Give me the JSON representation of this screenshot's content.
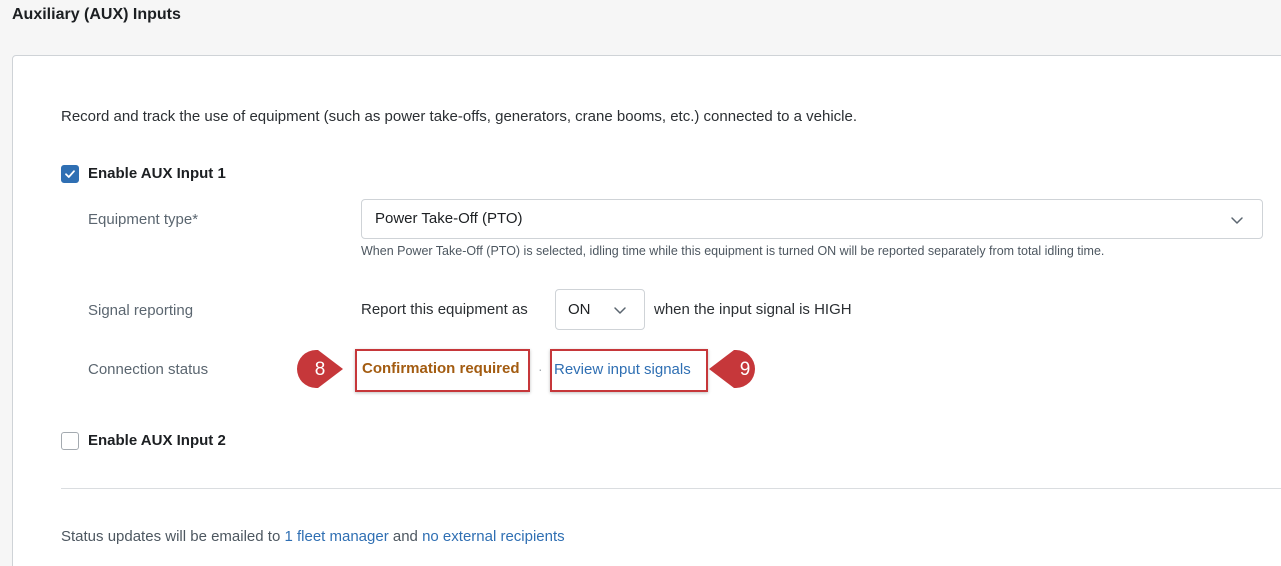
{
  "section": {
    "title": "Auxiliary (AUX) Inputs"
  },
  "description": "Record and track the use of equipment (such as power take-offs, generators, crane booms, etc.) connected to a vehicle.",
  "aux1": {
    "checkbox_label": "Enable AUX Input 1",
    "checked": true,
    "equipment_type": {
      "label": "Equipment type*",
      "value": "Power Take-Off (PTO)",
      "helper": "When Power Take-Off (PTO) is selected, idling time while this equipment is turned ON will be reported separately from total idling time."
    },
    "signal_reporting": {
      "label": "Signal reporting",
      "prefix": "Report this equipment as",
      "value": "ON",
      "suffix": "when the input signal is HIGH"
    },
    "connection_status": {
      "label": "Connection status",
      "status": "Confirmation required",
      "separator": "·",
      "link": "Review input signals"
    }
  },
  "aux2": {
    "checkbox_label": "Enable AUX Input 2",
    "checked": false
  },
  "footer": {
    "prefix": "Status updates will be emailed to",
    "link1": "1 fleet manager",
    "middle": "and",
    "link2": "no external recipients"
  },
  "annotations": {
    "badge_left": "8",
    "badge_right": "9"
  },
  "colors": {
    "accent": "#2f6fb3",
    "warning": "#a35c11",
    "annotation": "#c6373a"
  },
  "icons": {
    "checkbox_checked": "check-icon",
    "dropdown": "chevron-down-icon"
  }
}
